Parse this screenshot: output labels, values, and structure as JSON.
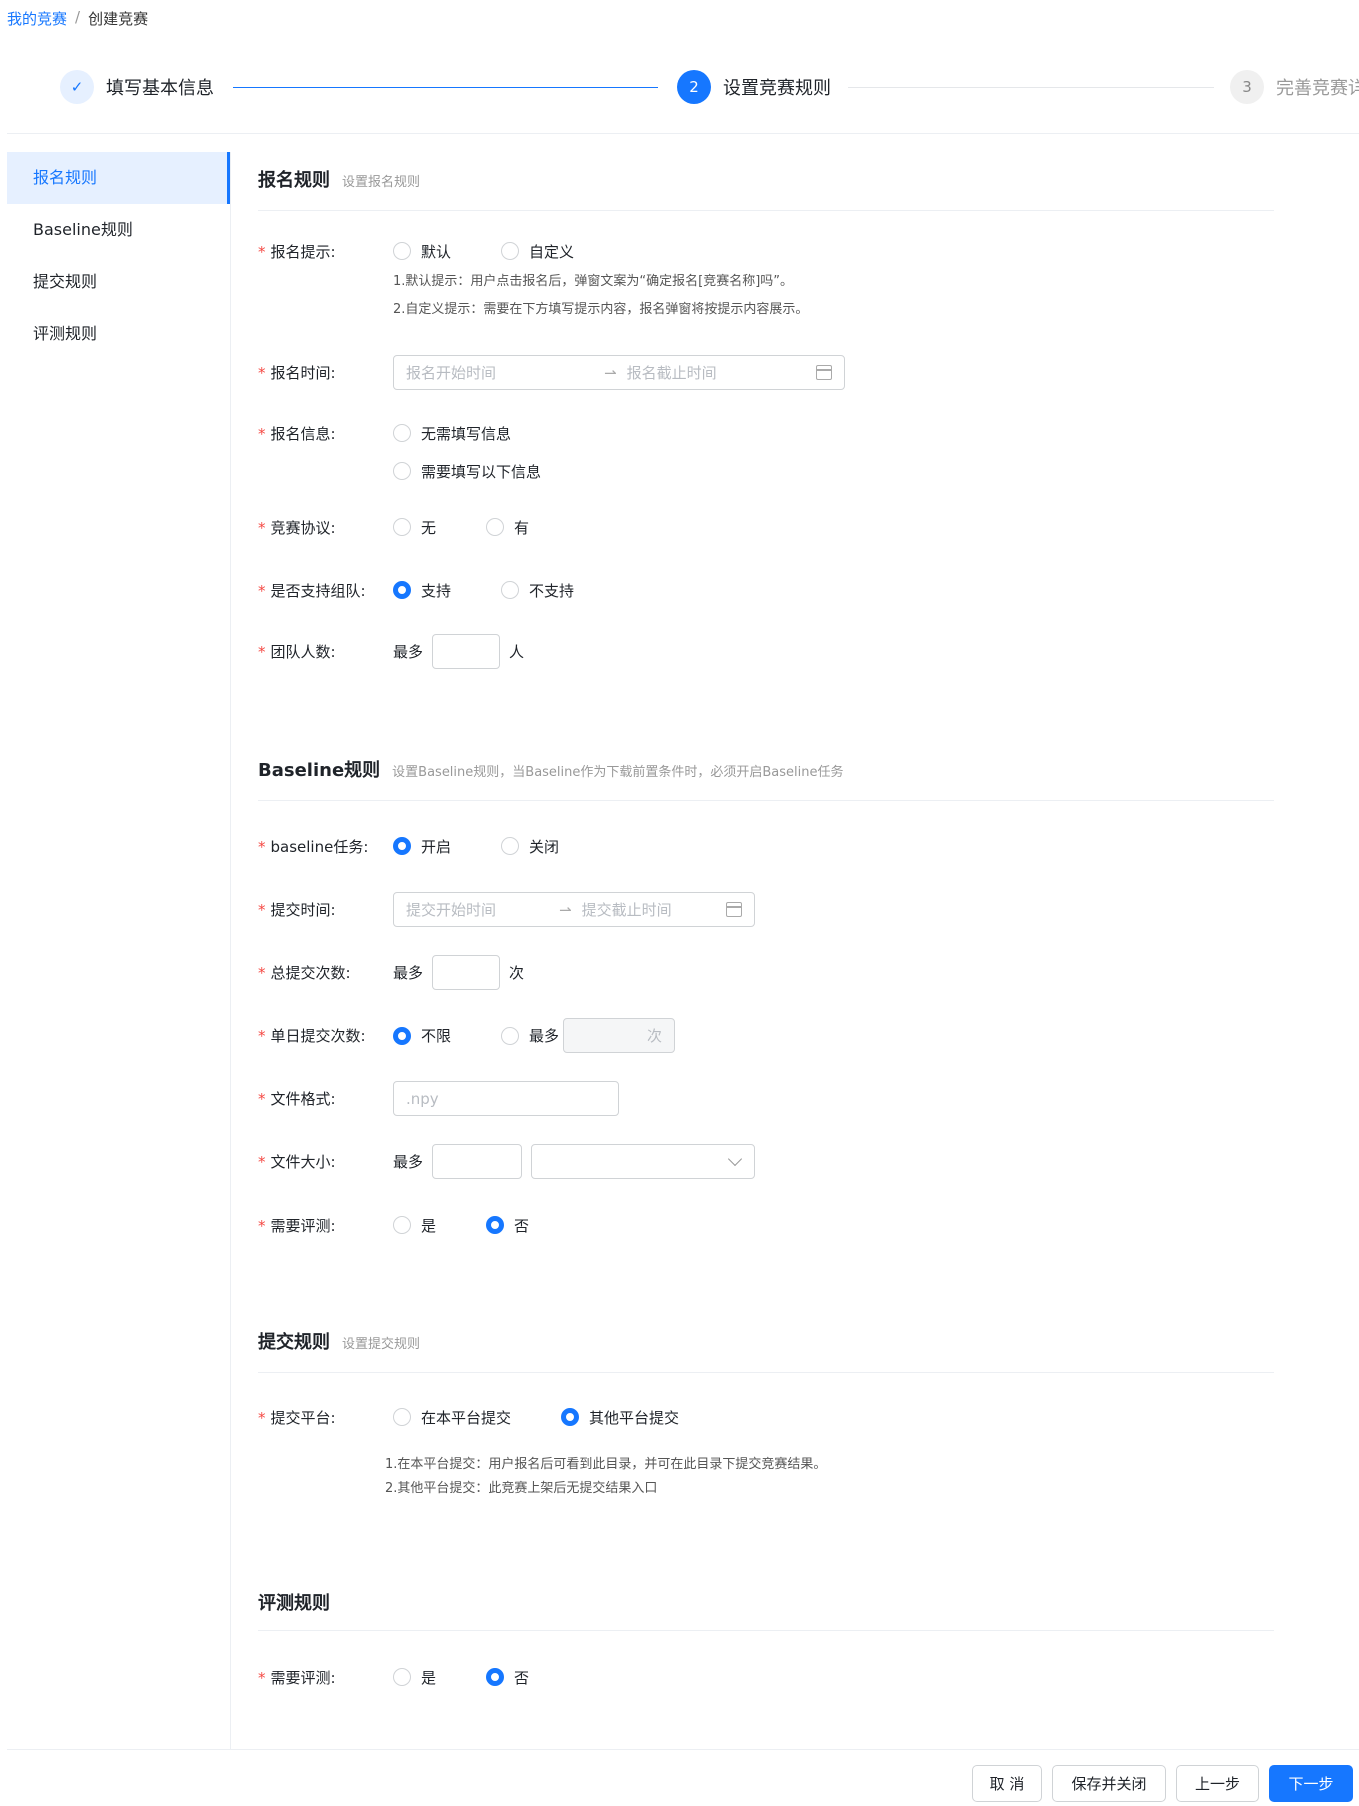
{
  "breadcrumb": {
    "parent": "我的竞赛",
    "separator": "/",
    "current": "创建竞赛"
  },
  "steps": [
    {
      "number": "✓",
      "title": "填写基本信息",
      "state": "done"
    },
    {
      "number": "2",
      "title": "设置竞赛规则",
      "state": "active"
    },
    {
      "number": "3",
      "title": "完善竞赛详情",
      "state": "wait"
    }
  ],
  "side_menu": [
    "报名规则",
    "Baseline规则",
    "提交规则",
    "评测规则"
  ],
  "registration": {
    "title": "报名规则",
    "subtitle": "设置报名规则",
    "prompt": {
      "label": "报名提示:",
      "options": [
        "默认",
        "自定义"
      ],
      "hint1": "1.默认提示：用户点击报名后，弹窗文案为“确定报名[竞赛名称]吗”。",
      "hint2": "2.自定义提示：需要在下方填写提示内容，报名弹窗将按提示内容展示。"
    },
    "time": {
      "label": "报名时间:",
      "start_placeholder": "报名开始时间",
      "end_placeholder": "报名截止时间"
    },
    "info": {
      "label": "报名信息:",
      "options": [
        "无需填写信息",
        "需要填写以下信息"
      ]
    },
    "agreement": {
      "label": "竞赛协议:",
      "options": [
        "无",
        "有"
      ]
    },
    "team": {
      "label": "是否支持组队:",
      "options": [
        "支持",
        "不支持"
      ],
      "selected": 0
    },
    "team_size": {
      "label": "团队人数:",
      "prefix": "最多",
      "suffix": "人"
    }
  },
  "baseline": {
    "title": "Baseline规则",
    "subtitle": "设置Baseline规则，当Baseline作为下载前置条件时，必须开启Baseline任务",
    "task": {
      "label": "baseline任务:",
      "options": [
        "开启",
        "关闭"
      ],
      "selected": 0
    },
    "time": {
      "label": "提交时间:",
      "start_placeholder": "提交开始时间",
      "end_placeholder": "提交截止时间"
    },
    "total": {
      "label": "总提交次数:",
      "prefix": "最多",
      "suffix": "次"
    },
    "daily": {
      "label": "单日提交次数:",
      "options": [
        "不限",
        "最多"
      ],
      "selected": 0,
      "suffix": "次"
    },
    "format": {
      "label": "文件格式:",
      "placeholder": ".npy"
    },
    "size": {
      "label": "文件大小:",
      "prefix": "最多"
    },
    "eval": {
      "label": "需要评测:",
      "options": [
        "是",
        "否"
      ],
      "selected": 1
    }
  },
  "submission": {
    "title": "提交规则",
    "subtitle": "设置提交规则",
    "platform": {
      "label": "提交平台:",
      "options": [
        "在本平台提交",
        "其他平台提交"
      ],
      "selected": 1
    },
    "hint1": "1.在本平台提交：用户报名后可看到此目录，并可在此目录下提交竞赛结果。",
    "hint2": "2.其他平台提交：此竞赛上架后无提交结果入口"
  },
  "evaluation": {
    "title": "评测规则",
    "eval": {
      "label": "需要评测:",
      "options": [
        "是",
        "否"
      ],
      "selected": 1
    }
  },
  "footer": {
    "cancel": "取 消",
    "save_close": "保存并关闭",
    "prev": "上一步",
    "next": "下一步"
  },
  "colors": {
    "primary": "#1677ff",
    "required": "#f54a45"
  }
}
